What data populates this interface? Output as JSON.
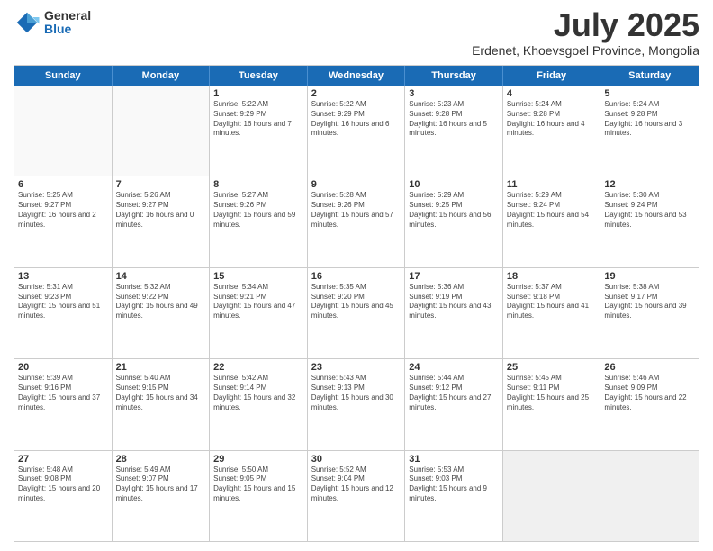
{
  "logo": {
    "general": "General",
    "blue": "Blue"
  },
  "title": "July 2025",
  "subtitle": "Erdenet, Khoevsgoel Province, Mongolia",
  "days": [
    "Sunday",
    "Monday",
    "Tuesday",
    "Wednesday",
    "Thursday",
    "Friday",
    "Saturday"
  ],
  "weeks": [
    [
      {
        "day": "",
        "info": ""
      },
      {
        "day": "",
        "info": ""
      },
      {
        "day": "1",
        "info": "Sunrise: 5:22 AM\nSunset: 9:29 PM\nDaylight: 16 hours and 7 minutes."
      },
      {
        "day": "2",
        "info": "Sunrise: 5:22 AM\nSunset: 9:29 PM\nDaylight: 16 hours and 6 minutes."
      },
      {
        "day": "3",
        "info": "Sunrise: 5:23 AM\nSunset: 9:28 PM\nDaylight: 16 hours and 5 minutes."
      },
      {
        "day": "4",
        "info": "Sunrise: 5:24 AM\nSunset: 9:28 PM\nDaylight: 16 hours and 4 minutes."
      },
      {
        "day": "5",
        "info": "Sunrise: 5:24 AM\nSunset: 9:28 PM\nDaylight: 16 hours and 3 minutes."
      }
    ],
    [
      {
        "day": "6",
        "info": "Sunrise: 5:25 AM\nSunset: 9:27 PM\nDaylight: 16 hours and 2 minutes."
      },
      {
        "day": "7",
        "info": "Sunrise: 5:26 AM\nSunset: 9:27 PM\nDaylight: 16 hours and 0 minutes."
      },
      {
        "day": "8",
        "info": "Sunrise: 5:27 AM\nSunset: 9:26 PM\nDaylight: 15 hours and 59 minutes."
      },
      {
        "day": "9",
        "info": "Sunrise: 5:28 AM\nSunset: 9:26 PM\nDaylight: 15 hours and 57 minutes."
      },
      {
        "day": "10",
        "info": "Sunrise: 5:29 AM\nSunset: 9:25 PM\nDaylight: 15 hours and 56 minutes."
      },
      {
        "day": "11",
        "info": "Sunrise: 5:29 AM\nSunset: 9:24 PM\nDaylight: 15 hours and 54 minutes."
      },
      {
        "day": "12",
        "info": "Sunrise: 5:30 AM\nSunset: 9:24 PM\nDaylight: 15 hours and 53 minutes."
      }
    ],
    [
      {
        "day": "13",
        "info": "Sunrise: 5:31 AM\nSunset: 9:23 PM\nDaylight: 15 hours and 51 minutes."
      },
      {
        "day": "14",
        "info": "Sunrise: 5:32 AM\nSunset: 9:22 PM\nDaylight: 15 hours and 49 minutes."
      },
      {
        "day": "15",
        "info": "Sunrise: 5:34 AM\nSunset: 9:21 PM\nDaylight: 15 hours and 47 minutes."
      },
      {
        "day": "16",
        "info": "Sunrise: 5:35 AM\nSunset: 9:20 PM\nDaylight: 15 hours and 45 minutes."
      },
      {
        "day": "17",
        "info": "Sunrise: 5:36 AM\nSunset: 9:19 PM\nDaylight: 15 hours and 43 minutes."
      },
      {
        "day": "18",
        "info": "Sunrise: 5:37 AM\nSunset: 9:18 PM\nDaylight: 15 hours and 41 minutes."
      },
      {
        "day": "19",
        "info": "Sunrise: 5:38 AM\nSunset: 9:17 PM\nDaylight: 15 hours and 39 minutes."
      }
    ],
    [
      {
        "day": "20",
        "info": "Sunrise: 5:39 AM\nSunset: 9:16 PM\nDaylight: 15 hours and 37 minutes."
      },
      {
        "day": "21",
        "info": "Sunrise: 5:40 AM\nSunset: 9:15 PM\nDaylight: 15 hours and 34 minutes."
      },
      {
        "day": "22",
        "info": "Sunrise: 5:42 AM\nSunset: 9:14 PM\nDaylight: 15 hours and 32 minutes."
      },
      {
        "day": "23",
        "info": "Sunrise: 5:43 AM\nSunset: 9:13 PM\nDaylight: 15 hours and 30 minutes."
      },
      {
        "day": "24",
        "info": "Sunrise: 5:44 AM\nSunset: 9:12 PM\nDaylight: 15 hours and 27 minutes."
      },
      {
        "day": "25",
        "info": "Sunrise: 5:45 AM\nSunset: 9:11 PM\nDaylight: 15 hours and 25 minutes."
      },
      {
        "day": "26",
        "info": "Sunrise: 5:46 AM\nSunset: 9:09 PM\nDaylight: 15 hours and 22 minutes."
      }
    ],
    [
      {
        "day": "27",
        "info": "Sunrise: 5:48 AM\nSunset: 9:08 PM\nDaylight: 15 hours and 20 minutes."
      },
      {
        "day": "28",
        "info": "Sunrise: 5:49 AM\nSunset: 9:07 PM\nDaylight: 15 hours and 17 minutes."
      },
      {
        "day": "29",
        "info": "Sunrise: 5:50 AM\nSunset: 9:05 PM\nDaylight: 15 hours and 15 minutes."
      },
      {
        "day": "30",
        "info": "Sunrise: 5:52 AM\nSunset: 9:04 PM\nDaylight: 15 hours and 12 minutes."
      },
      {
        "day": "31",
        "info": "Sunrise: 5:53 AM\nSunset: 9:03 PM\nDaylight: 15 hours and 9 minutes."
      },
      {
        "day": "",
        "info": ""
      },
      {
        "day": "",
        "info": ""
      }
    ]
  ]
}
